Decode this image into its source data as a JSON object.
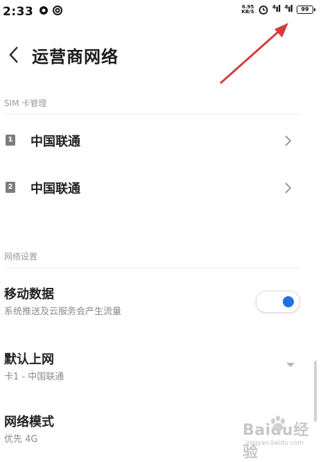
{
  "status_bar": {
    "time": "2:33",
    "net_speed_value": "6.95",
    "net_speed_unit": "KB/S",
    "battery": "99"
  },
  "header": {
    "title": "运营商网络"
  },
  "sim_section": {
    "label": "SIM 卡管理",
    "cards": [
      {
        "badge": "1",
        "carrier": "中国联通"
      },
      {
        "badge": "2",
        "carrier": "中国联通"
      }
    ]
  },
  "network_section": {
    "label": "网络设置",
    "mobile_data": {
      "title": "移动数据",
      "subtitle": "系统推送及云服务会产生流量",
      "enabled": true
    },
    "default_data": {
      "title": "默认上网",
      "value": "卡1 - 中国联通"
    },
    "network_mode": {
      "title": "网络模式",
      "value": "优先 4G"
    }
  },
  "watermark": {
    "text": "Baidu经验",
    "url": "jingyan.baidu.com"
  },
  "colors": {
    "accent": "#1e72e6",
    "annotation_arrow": "#d63a3a"
  }
}
